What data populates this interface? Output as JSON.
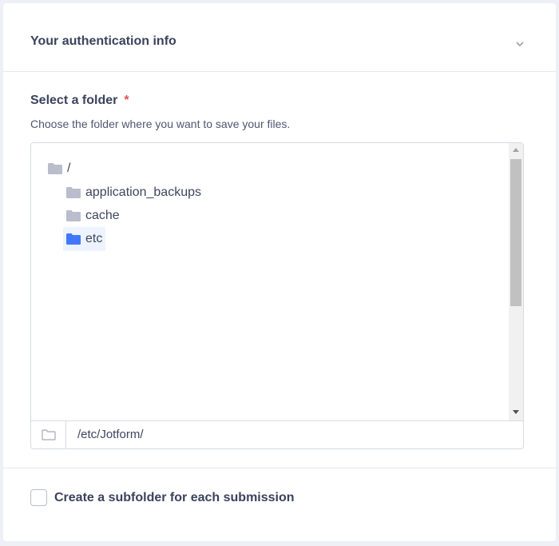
{
  "auth": {
    "title": "Your authentication info",
    "expand_icon": "chevron-down-icon"
  },
  "folder_field": {
    "label": "Select a folder",
    "required_mark": "*",
    "description": "Choose the folder where you want to save your files."
  },
  "tree": {
    "root": {
      "label": "/",
      "icon": "folder-icon"
    },
    "children": [
      {
        "label": "application_backups",
        "icon": "folder-icon",
        "selected": false
      },
      {
        "label": "cache",
        "icon": "folder-icon",
        "selected": false
      },
      {
        "label": "etc",
        "icon": "folder-icon",
        "selected": true
      }
    ],
    "selected_color": "#4277ff",
    "folder_color": "#b9bdcc"
  },
  "path": {
    "value": "/etc/Jotform/",
    "icon": "folder-outline-icon"
  },
  "subfolder_option": {
    "label": "Create a subfolder for each submission",
    "checked": false
  }
}
